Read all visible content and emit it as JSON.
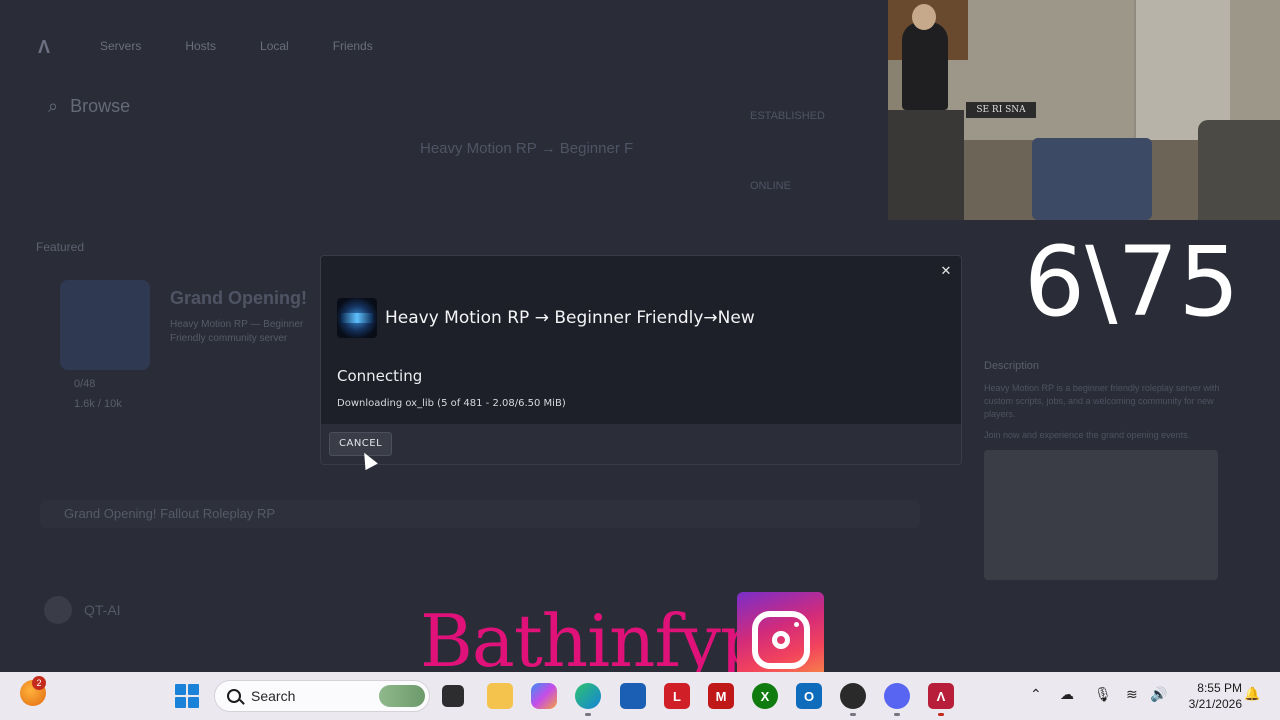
{
  "background_app": {
    "nav_items": [
      "Servers",
      "Hosts",
      "Local",
      "Friends"
    ],
    "search_title": "Browse",
    "list_heading": "Featured",
    "featured_title": "Grand Opening!",
    "featured_sub": "Heavy Motion RP — Beginner Friendly community server",
    "meta_players": "0/48",
    "meta_ping": "1.6k / 10k",
    "server_row_text": "Grand Opening! Fallout Roleplay RP",
    "right_title": "Heavy Motion RP → Beginner F",
    "right_label_1": "ESTABLISHED",
    "right_label_2": "ONLINE",
    "side_heading": "Description",
    "side_text": "Heavy Motion RP is a beginner friendly roleplay server with custom scripts, jobs, and a welcoming community for new players.",
    "side_text_2": "Join now and experience the grand opening events.",
    "bottom_row_text": "QT-AI"
  },
  "webcam": {
    "sign_text": "SE RI SNA"
  },
  "overlay_counter": "6\\75",
  "modal": {
    "server_name": "Heavy Motion RP → Beginner Friendly→New",
    "status": "Connecting",
    "download_status": "Downloading ox_lib (5 of 481 - 2.08/6.50 MiB)",
    "cancel_label": "CANCEL",
    "close_glyph": "✕"
  },
  "watermark": {
    "text": "Bathinfyp"
  },
  "taskbar": {
    "notification_badge": "2",
    "search_label": "Search",
    "clock_time": "8:55 PM",
    "clock_date": "3/21/2026",
    "pinned_apps": [
      "task-view",
      "file-explorer",
      "copilot",
      "edge",
      "store",
      "lastpass",
      "mcafee",
      "xbox",
      "outlook",
      "obs",
      "discord",
      "app-launcher"
    ],
    "tray_icons": [
      "chevron-up",
      "onedrive",
      "microphone",
      "wifi",
      "speaker"
    ],
    "accent": "#1a82d8"
  }
}
